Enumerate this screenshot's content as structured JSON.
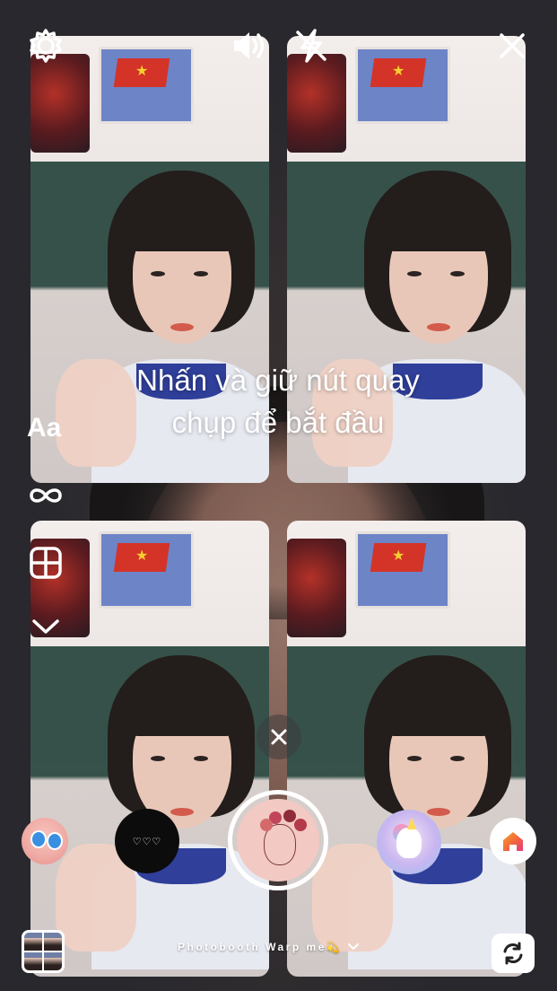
{
  "top_bar": {
    "settings_icon": "gear-icon",
    "sound_icon": "speaker-icon",
    "flash_icon": "flash-off-icon",
    "close_icon": "close-icon"
  },
  "side_tools": {
    "text_label": "Aa",
    "boomerang_icon": "infinity-icon",
    "layout_icon": "layout-grid-icon",
    "more_icon": "chevron-down-icon"
  },
  "hint": {
    "line1": "Nhấn và giữ nút quay",
    "line2": "chụp để bắt đầu"
  },
  "effects": {
    "dismiss_icon": "close-icon",
    "items": [
      {
        "name": "doraemon-effect"
      },
      {
        "name": "hearts-effect",
        "label": "♡♡♡"
      },
      {
        "name": "flower-sketch-effect",
        "selected": true
      },
      {
        "name": "unicorn-effect"
      },
      {
        "name": "home-effect"
      }
    ]
  },
  "bottom_bar": {
    "effect_name": "Photobooth Warp me💫",
    "dropdown_icon": "chevron-down-icon",
    "gallery_icon": "gallery-thumbnail",
    "flip_icon": "camera-flip-icon"
  },
  "colors": {
    "text": "#ffffff",
    "home_icon_orange": "#f26b3a",
    "home_icon_pink": "#e63a7a"
  }
}
